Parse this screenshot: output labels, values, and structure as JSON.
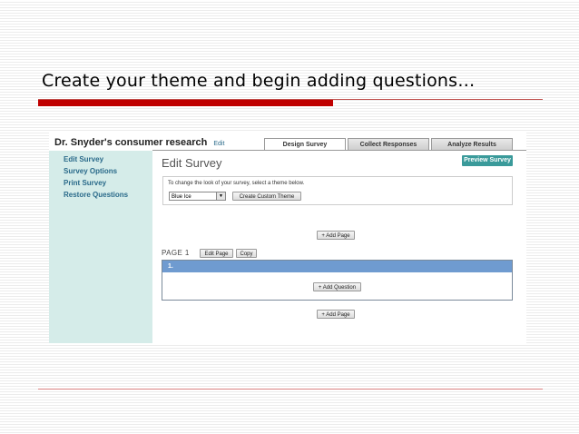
{
  "slide": {
    "title": "Create your theme and begin adding questions…"
  },
  "app": {
    "survey_title": "Dr. Snyder's consumer research",
    "edit_link": "Edit",
    "tabs": [
      {
        "label": "Design Survey",
        "active": true
      },
      {
        "label": "Collect Responses",
        "active": false
      },
      {
        "label": "Analyze Results",
        "active": false
      }
    ],
    "sidebar": {
      "items": [
        {
          "label": "Edit Survey"
        },
        {
          "label": "Survey Options"
        },
        {
          "label": "Print Survey"
        },
        {
          "label": "Restore Questions"
        }
      ]
    },
    "main": {
      "heading": "Edit Survey",
      "preview_button": "Preview Survey",
      "theme": {
        "instruction": "To change the look of your survey, select a theme below.",
        "selected": "Blue Ice",
        "custom_button": "Create Custom Theme"
      },
      "add_page_label": "+ Add Page",
      "page": {
        "label": "PAGE 1",
        "edit_button": "Edit Page",
        "copy_button": "Copy",
        "question_number": "1.",
        "add_question_button": "+ Add Question"
      },
      "add_page_label_bottom": "+ Add Page"
    }
  },
  "colors": {
    "accent_red": "#c00000",
    "sidebar_bg": "#d5ece9",
    "preview_button": "#3a9a9a",
    "question_header": "#6f9bd0",
    "link": "#2a6a8a"
  }
}
